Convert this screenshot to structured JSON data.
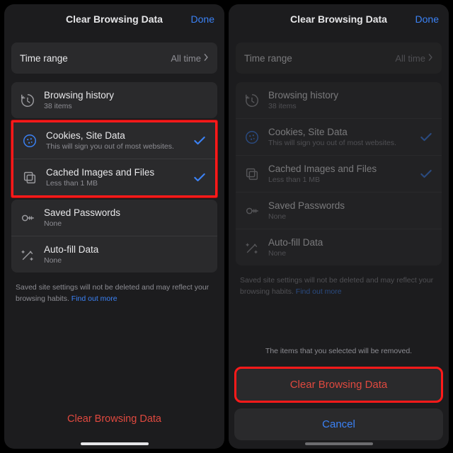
{
  "left": {
    "header": {
      "title": "Clear Browsing Data",
      "done": "Done"
    },
    "timeRange": {
      "label": "Time range",
      "value": "All time"
    },
    "items": [
      {
        "title": "Browsing history",
        "sub": "38 items",
        "icon": "history-icon",
        "checked": false
      },
      {
        "title": "Cookies, Site Data",
        "sub": "This will sign you out of most websites.",
        "icon": "cookie-icon",
        "checked": true
      },
      {
        "title": "Cached Images and Files",
        "sub": "Less than 1 MB",
        "icon": "cache-icon",
        "checked": true
      },
      {
        "title": "Saved Passwords",
        "sub": "None",
        "icon": "key-icon",
        "checked": false
      },
      {
        "title": "Auto-fill Data",
        "sub": "None",
        "icon": "wand-icon",
        "checked": false
      }
    ],
    "footnote": "Saved site settings will not be deleted and may reflect your browsing habits.",
    "footnoteLink": "Find out more",
    "clear": "Clear Browsing Data"
  },
  "right": {
    "header": {
      "title": "Clear Browsing Data",
      "done": "Done"
    },
    "timeRange": {
      "label": "Time range",
      "value": "All time"
    },
    "items": [
      {
        "title": "Browsing history",
        "sub": "38 items",
        "icon": "history-icon",
        "checked": false
      },
      {
        "title": "Cookies, Site Data",
        "sub": "This will sign you out of most websites.",
        "icon": "cookie-icon",
        "checked": true
      },
      {
        "title": "Cached Images and Files",
        "sub": "Less than 1 MB",
        "icon": "cache-icon",
        "checked": true
      },
      {
        "title": "Saved Passwords",
        "sub": "None",
        "icon": "key-icon",
        "checked": false
      },
      {
        "title": "Auto-fill Data",
        "sub": "None",
        "icon": "wand-icon",
        "checked": false
      }
    ],
    "footnote": "Saved site settings will not be deleted and may reflect your browsing habits.",
    "footnoteLink": "Find out more",
    "sheet": {
      "message": "The items that you selected will be removed.",
      "confirm": "Clear Browsing Data",
      "cancel": "Cancel"
    }
  }
}
